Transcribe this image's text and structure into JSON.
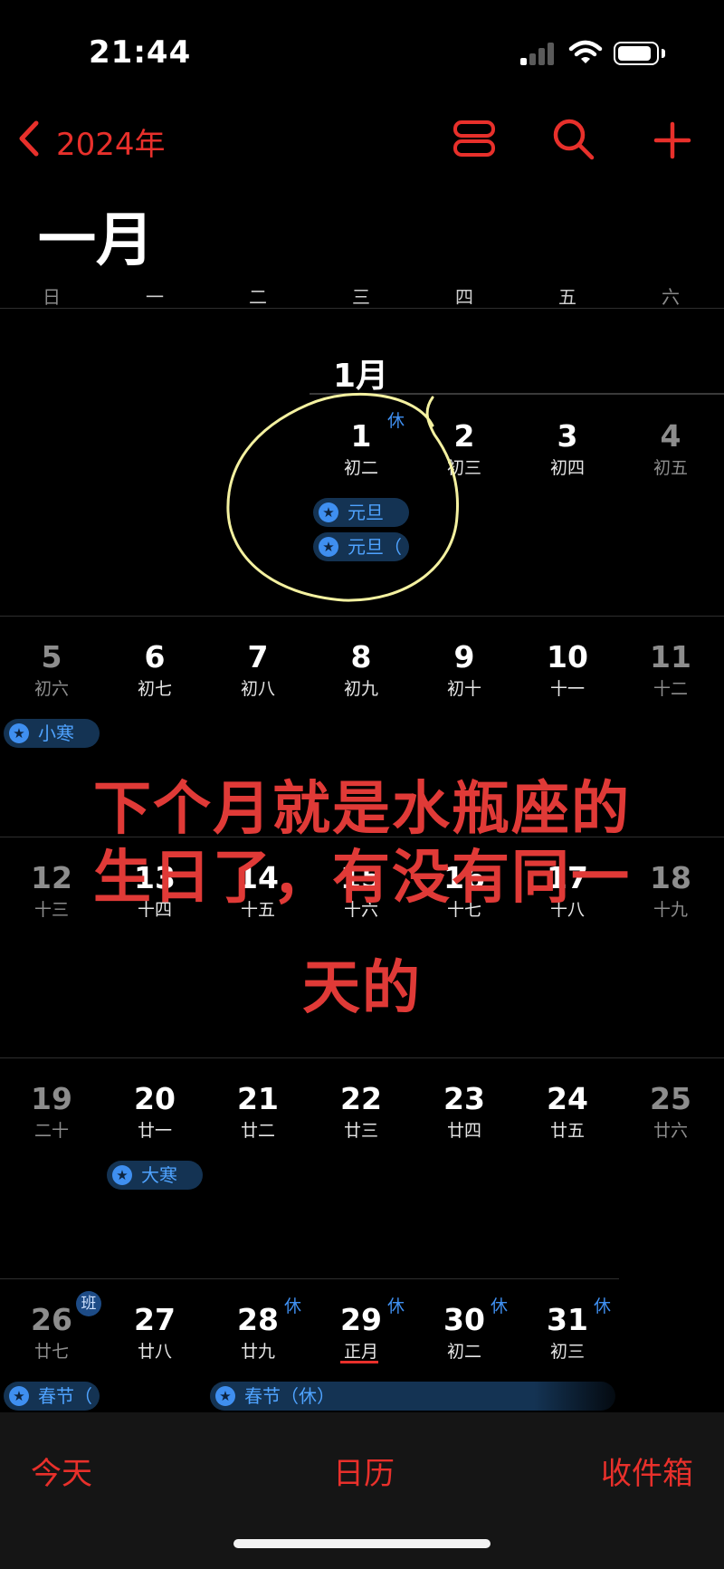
{
  "status_bar": {
    "time": "21:44"
  },
  "nav": {
    "back_label": "2024年"
  },
  "month_title": "一月",
  "weekdays": [
    "日",
    "一",
    "二",
    "三",
    "四",
    "五",
    "六"
  ],
  "month_label": "1月",
  "weeks": [
    {
      "days": [
        {
          "num": "1",
          "lunar": "初二",
          "badge": "休"
        },
        {
          "num": "2",
          "lunar": "初三"
        },
        {
          "num": "3",
          "lunar": "初四"
        },
        {
          "num": "4",
          "lunar": "初五"
        }
      ]
    },
    {
      "days": [
        {
          "num": "5",
          "lunar": "初六"
        },
        {
          "num": "6",
          "lunar": "初七"
        },
        {
          "num": "7",
          "lunar": "初八"
        },
        {
          "num": "8",
          "lunar": "初九"
        },
        {
          "num": "9",
          "lunar": "初十"
        },
        {
          "num": "10",
          "lunar": "十一"
        },
        {
          "num": "11",
          "lunar": "十二"
        }
      ]
    },
    {
      "days": [
        {
          "num": "12",
          "lunar": "十三"
        },
        {
          "num": "13",
          "lunar": "十四"
        },
        {
          "num": "14",
          "lunar": "十五"
        },
        {
          "num": "15",
          "lunar": "十六"
        },
        {
          "num": "16",
          "lunar": "十七"
        },
        {
          "num": "17",
          "lunar": "十八"
        },
        {
          "num": "18",
          "lunar": "十九"
        }
      ]
    },
    {
      "days": [
        {
          "num": "19",
          "lunar": "二十"
        },
        {
          "num": "20",
          "lunar": "廿一"
        },
        {
          "num": "21",
          "lunar": "廿二"
        },
        {
          "num": "22",
          "lunar": "廿三"
        },
        {
          "num": "23",
          "lunar": "廿四"
        },
        {
          "num": "24",
          "lunar": "廿五"
        },
        {
          "num": "25",
          "lunar": "廿六"
        }
      ]
    },
    {
      "days": [
        {
          "num": "26",
          "lunar": "廿七",
          "badge": "班"
        },
        {
          "num": "27",
          "lunar": "廿八"
        },
        {
          "num": "28",
          "lunar": "廿九",
          "badge": "休"
        },
        {
          "num": "29",
          "lunar": "正月",
          "badge": "休"
        },
        {
          "num": "30",
          "lunar": "初二",
          "badge": "休"
        },
        {
          "num": "31",
          "lunar": "初三",
          "badge": "休"
        }
      ]
    }
  ],
  "events": {
    "yuandan_1": "元旦",
    "yuandan_2": "元旦（",
    "xiaohan": "小寒",
    "dahan": "大寒",
    "chunjie_1": "春节（",
    "chunjie_2": "春节（休）"
  },
  "overlay_text": {
    "line1": "下个月就是水瓶座的",
    "line2": "生日了，有没有同一",
    "line3": "天的"
  },
  "tabs": {
    "today": "今天",
    "calendars": "日历",
    "inbox": "收件箱"
  },
  "colors": {
    "accent": "#e8302b",
    "holiday_blue": "#3f8ff0",
    "overlay_red": "#e03a37",
    "circle_highlight": "#f4f1a0"
  }
}
